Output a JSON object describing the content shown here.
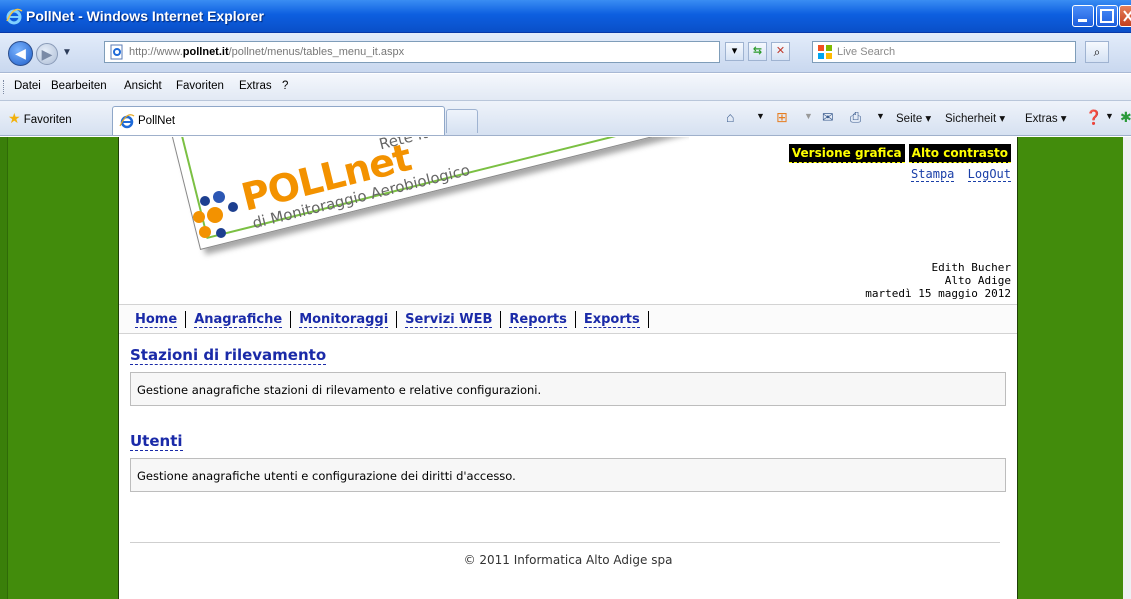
{
  "window": {
    "title": "PollNet - Windows Internet Explorer"
  },
  "address_bar": {
    "url_prefix": "http://www.",
    "url_domain": "pollnet.it",
    "url_path": "/pollnet/menus/tables_menu_it.aspx",
    "search_placeholder": "Live Search"
  },
  "menu_bar": {
    "items": [
      "Datei",
      "Bearbeiten",
      "Ansicht",
      "Favoriten",
      "Extras",
      "?"
    ]
  },
  "tab_bar": {
    "favorites_label": "Favoriten",
    "tab_label": "PollNet",
    "commands": [
      "Seite",
      "Sicherheit",
      "Extras"
    ]
  },
  "site": {
    "logo_brand": "POLLnet",
    "logo_line1": "Rete Italiana",
    "logo_line2": "Monitoraggio Aerobiologico",
    "logo_prefix": "di",
    "mode_buttons": [
      "Versione grafica",
      "Alto contrasto"
    ],
    "top_links": [
      "Stampa",
      "LogOut"
    ],
    "user": {
      "name": "Edith Bucher",
      "region": "Alto Adige",
      "date": "martedì 15 maggio 2012"
    },
    "nav": [
      "Home",
      "Anagrafiche",
      "Monitoraggi",
      "Servizi WEB",
      "Reports",
      "Exports"
    ],
    "sections": [
      {
        "title": "Stazioni di rilevamento",
        "description": "Gestione anagrafiche stazioni di rilevamento e relative configurazioni."
      },
      {
        "title": "Utenti",
        "description": "Gestione anagrafiche utenti e configurazione dei diritti d'accesso."
      }
    ],
    "footer": "© 2011 Informatica Alto Adige spa"
  },
  "colors": {
    "background_green": "#428c0c",
    "link_blue": "#1a2aa8",
    "brand_orange": "#f39200",
    "contrast_yellow": "#ffff00"
  }
}
